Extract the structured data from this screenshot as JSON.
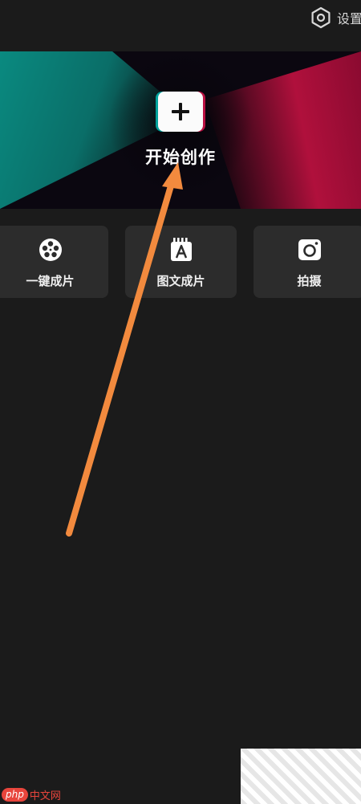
{
  "header": {
    "settings_label": "设置",
    "settings_icon": "hexagon-gear-icon"
  },
  "hero": {
    "start_label": "开始创作",
    "plus_icon": "plus-icon",
    "colors": {
      "teal": "#0a8a80",
      "magenta": "#b0103c",
      "dark": "#0b0710"
    }
  },
  "actions": [
    {
      "label": "一键成片",
      "icon": "film-reel-icon"
    },
    {
      "label": "图文成片",
      "icon": "text-image-icon"
    },
    {
      "label": "拍摄",
      "icon": "camera-icon"
    }
  ],
  "annotation": {
    "color": "#f28a3e"
  },
  "watermark": {
    "brand": "php",
    "site": "中文网",
    "color": "#e8453c"
  }
}
